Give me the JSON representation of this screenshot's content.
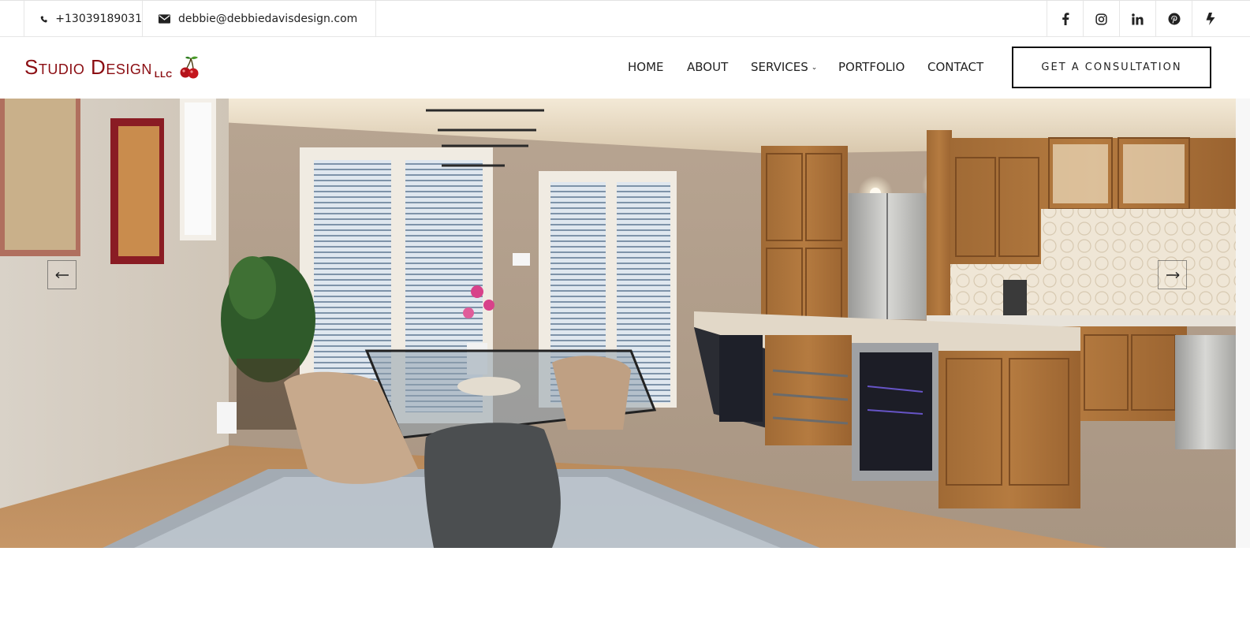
{
  "topbar": {
    "phone": "+13039189031",
    "email": "debbie@debbiedavisdesign.com",
    "phone_icon": "phone-icon",
    "email_icon": "envelope-icon",
    "social": [
      "facebook-icon",
      "instagram-icon",
      "linkedin-icon",
      "pinterest-icon",
      "houzz-icon"
    ]
  },
  "logo": {
    "main": "Studio Design",
    "sub": "LLC",
    "color": "#8b0d12"
  },
  "nav": {
    "items": [
      {
        "label": "HOME"
      },
      {
        "label": "ABOUT"
      },
      {
        "label": "SERVICES",
        "has_dropdown": true
      },
      {
        "label": "PORTFOLIO"
      },
      {
        "label": "CONTACT"
      }
    ],
    "cta": "GET A CONSULTATION"
  },
  "hero": {
    "prev_icon": "arrow-left-icon",
    "next_icon": "arrow-right-icon"
  }
}
